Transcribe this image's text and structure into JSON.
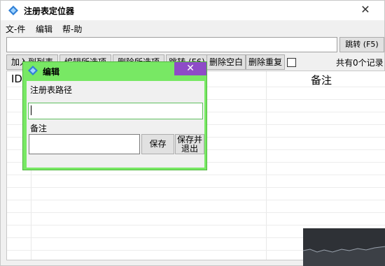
{
  "window": {
    "title": "注册表定位器",
    "close_glyph": "✕"
  },
  "menu": [
    {
      "label": "文-件"
    },
    {
      "label": "编辑"
    },
    {
      "label": "帮-助"
    }
  ],
  "path_bar": {
    "value": "",
    "jump_label": "跳转 (F5)"
  },
  "toolbar": {
    "buttons": [
      {
        "label": "加入到列表"
      },
      {
        "label": "编辑所选项"
      },
      {
        "label": "删除所选项"
      },
      {
        "label": "跳转 (F6)"
      },
      {
        "label": "删除空白"
      },
      {
        "label": "删除重复"
      }
    ],
    "count_text": "共有0个记录"
  },
  "table": {
    "columns": [
      {
        "label": "ID"
      },
      {
        "label": "备注"
      }
    ]
  },
  "dialog": {
    "title": "编辑",
    "close_glyph": "✕",
    "path_label": "注册表路径",
    "path_value": "",
    "note_label": "备注",
    "note_value": "",
    "save_label": "保存",
    "save_exit_label": "保存并\n退出"
  },
  "colors": {
    "dialog_frame": "#78e864",
    "dialog_close": "#8e4bc7"
  },
  "icons": {
    "app": "diamond-app-icon",
    "dialog": "diamond-app-icon"
  }
}
